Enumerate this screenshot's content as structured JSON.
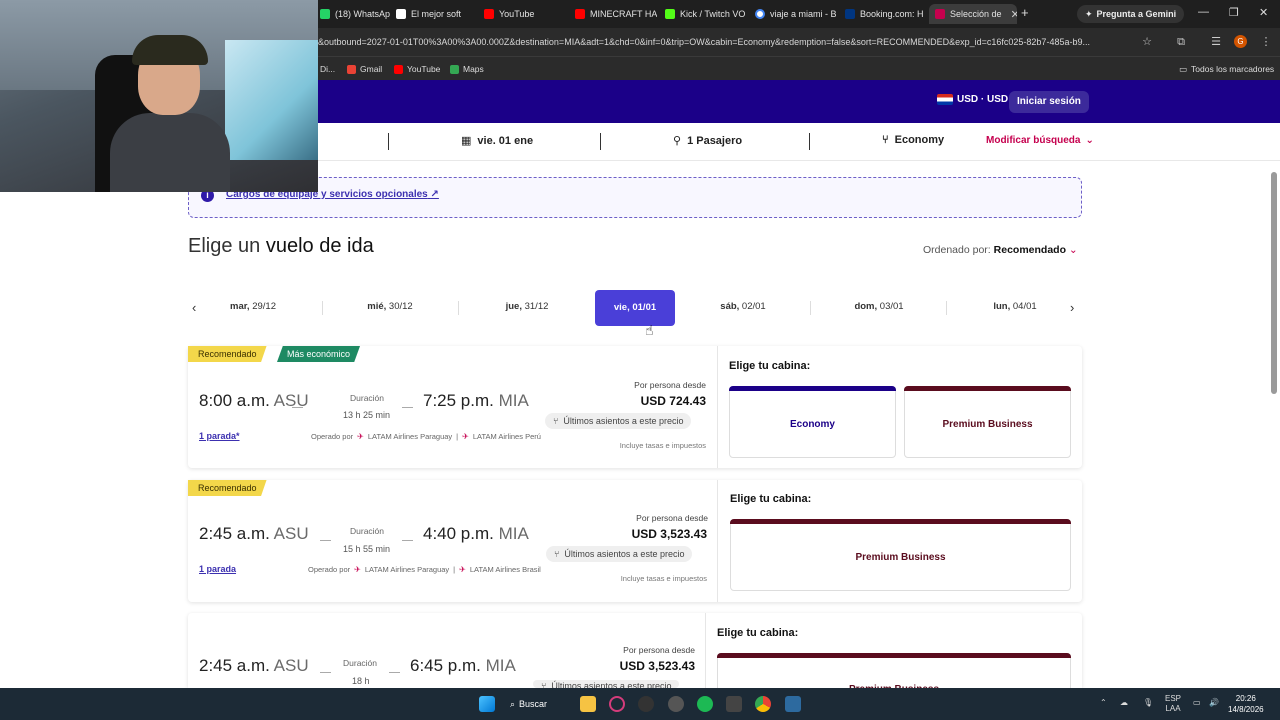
{
  "browser": {
    "tabs": [
      {
        "label": "(18) WhatsApp",
        "color": "#25d366"
      },
      {
        "label": "El mejor soft",
        "color": "#ffffff"
      },
      {
        "label": "YouTube",
        "color": "#ff0000"
      },
      {
        "label": "MINECRAFT HA",
        "color": "#ff0000"
      },
      {
        "label": "Kick / Twitch VO",
        "color": "#53fc18"
      },
      {
        "label": "viaje a miami - B",
        "color": "#4285f4"
      },
      {
        "label": "Booking.com: H",
        "color": "#003580"
      },
      {
        "label": "Selección de",
        "color": "#c5004e"
      }
    ],
    "gemini_label": "Pregunta a Gemini",
    "url": "&outbound=2027-01-01T00%3A00%3A00.000Z&destination=MIA&adt=1&chd=0&inf=0&trip=OW&cabin=Economy&redemption=false&sort=RECOMMENDED&exp_id=c16fc025-82b7-485a-b9...",
    "profile_letter": "G",
    "bookmarks": [
      {
        "label": "Di...",
        "color": "#888888"
      },
      {
        "label": "Gmail",
        "color": "#ea4335"
      },
      {
        "label": "YouTube",
        "color": "#ff0000"
      },
      {
        "label": "Maps",
        "color": "#34a853"
      }
    ],
    "all_bookmarks": "Todos los marcadores"
  },
  "header": {
    "currency": "USD · USD",
    "login": "Iniciar sesión"
  },
  "search": {
    "date": "vie. 01 ene",
    "passengers": "1 Pasajero",
    "cabin": "Economy",
    "modify": "Modificar búsqueda"
  },
  "info": {
    "link": "Cargos de equipaje y servicios opcionales"
  },
  "main": {
    "title_a": "Elige un ",
    "title_b": "vuelo de ida",
    "sort_label": "Ordenado por: ",
    "sort_value": "Recomendado"
  },
  "dates": [
    {
      "day": "mar,",
      "date": " 29/12"
    },
    {
      "day": "mié,",
      "date": " 30/12"
    },
    {
      "day": "jue,",
      "date": " 31/12"
    },
    {
      "day": "vie,",
      "date": " 01/01"
    },
    {
      "day": "sáb,",
      "date": " 02/01"
    },
    {
      "day": "dom,",
      "date": " 03/01"
    },
    {
      "day": "lun,",
      "date": " 04/01"
    }
  ],
  "flights": [
    {
      "tags": [
        "Recomendado",
        "Más económico"
      ],
      "depart": "8:00 a.m.",
      "from": "ASU",
      "duration_label": "Duración",
      "duration": "13 h 25 min",
      "arrive": "7:25 p.m.",
      "to": "MIA",
      "stops": "1 parada*",
      "operated_by": "Operado por",
      "airline1": "LATAM Airlines Paraguay",
      "airline2": "LATAM Airlines Perú",
      "per_person": "Por persona desde",
      "price": "USD 724.43",
      "seats": "Últimos asientos a este precio",
      "taxes": "Incluye tasas e impuestos",
      "cabin_title": "Elige tu cabina:",
      "cabins": [
        {
          "name": "Economy",
          "color": "#1b0088"
        },
        {
          "name": "Premium Business",
          "color": "#5a0c1e"
        }
      ]
    },
    {
      "tags": [
        "Recomendado"
      ],
      "depart": "2:45 a.m.",
      "from": "ASU",
      "duration_label": "Duración",
      "duration": "15 h 55 min",
      "arrive": "4:40 p.m.",
      "to": "MIA",
      "stops": "1 parada",
      "operated_by": "Operado por",
      "airline1": "LATAM Airlines Paraguay",
      "airline2": "LATAM Airlines Brasil",
      "per_person": "Por persona desde",
      "price": "USD 3,523.43",
      "seats": "Últimos asientos a este precio",
      "taxes": "Incluye tasas e impuestos",
      "cabin_title": "Elige tu cabina:",
      "cabins": [
        {
          "name": "Premium Business",
          "color": "#5a0c1e"
        }
      ]
    },
    {
      "depart": "2:45 a.m.",
      "from": "ASU",
      "duration_label": "Duración",
      "duration": "18 h",
      "arrive": "6:45 p.m.",
      "to": "MIA",
      "per_person": "Por persona desde",
      "price": "USD 3,523.43",
      "seats": "Últimos asientos a este precio",
      "cabin_title": "Elige tu cabina:",
      "cabins": [
        {
          "name": "Premium Business",
          "color": "#5a0c1e"
        }
      ]
    }
  ],
  "taskbar": {
    "search": "Buscar",
    "lang1": "ESP",
    "lang2": "LAA",
    "time": "20:26",
    "date": "14/8/2026"
  }
}
